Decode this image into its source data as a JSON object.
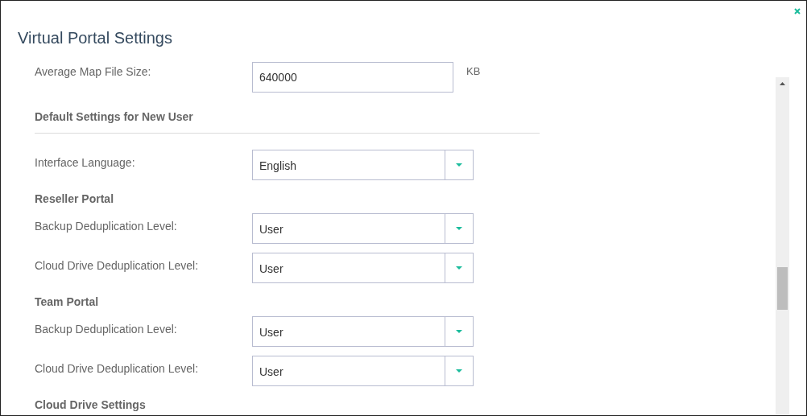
{
  "window": {
    "title": "Virtual Portal Settings"
  },
  "rows": [
    {
      "kind": "text_field",
      "label": "Average Map File Size:",
      "value": "640000",
      "unit": "KB"
    },
    {
      "kind": "section",
      "label": "Default Settings for New User"
    },
    {
      "kind": "dropdown",
      "label": "Interface Language:",
      "value": "English"
    },
    {
      "kind": "subsection",
      "label": "Reseller Portal"
    },
    {
      "kind": "dropdown",
      "label": "Backup Deduplication Level:",
      "value": "User"
    },
    {
      "kind": "dropdown",
      "label": "Cloud Drive Deduplication Level:",
      "value": "User"
    },
    {
      "kind": "subsection",
      "label": "Team Portal"
    },
    {
      "kind": "dropdown",
      "label": "Backup Deduplication Level:",
      "value": "User"
    },
    {
      "kind": "dropdown",
      "label": "Cloud Drive Deduplication Level:",
      "value": "User"
    },
    {
      "kind": "subsection",
      "label": "Cloud Drive Settings"
    }
  ]
}
